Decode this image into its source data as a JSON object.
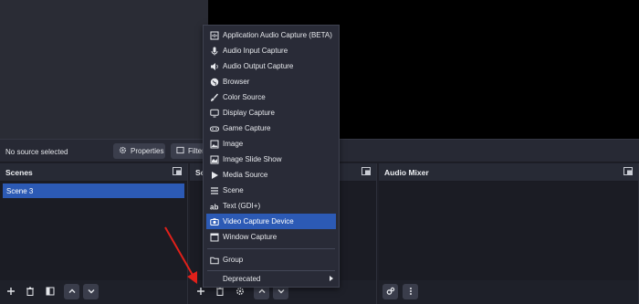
{
  "preview": {
    "status_text": "No source selected"
  },
  "source_toolbar": {
    "properties_label": "Properties",
    "filters_label": "Filters"
  },
  "docks": {
    "scenes_title": "Scenes",
    "sources_title": "So",
    "mixer_title": "Audio Mixer"
  },
  "scenes": {
    "items": [
      "Scene 3"
    ]
  },
  "add_source_menu": {
    "items": [
      {
        "label": "Application Audio Capture (BETA)",
        "icon": "app-audio-icon"
      },
      {
        "label": "Audio Input Capture",
        "icon": "microphone-icon"
      },
      {
        "label": "Audio Output Capture",
        "icon": "speaker-icon"
      },
      {
        "label": "Browser",
        "icon": "globe-icon"
      },
      {
        "label": "Color Source",
        "icon": "paintbrush-icon"
      },
      {
        "label": "Display Capture",
        "icon": "monitor-icon"
      },
      {
        "label": "Game Capture",
        "icon": "gamepad-icon"
      },
      {
        "label": "Image",
        "icon": "image-icon"
      },
      {
        "label": "Image Slide Show",
        "icon": "slideshow-icon"
      },
      {
        "label": "Media Source",
        "icon": "play-icon"
      },
      {
        "label": "Scene",
        "icon": "list-icon"
      },
      {
        "label": "Text (GDI+)",
        "icon": "text-icon"
      },
      {
        "label": "Video Capture Device",
        "icon": "camera-icon",
        "highlighted": true
      },
      {
        "label": "Window Capture",
        "icon": "window-icon"
      },
      {
        "label": "Group",
        "icon": "folder-icon"
      },
      {
        "label": "Deprecated",
        "icon": "",
        "submenu": true
      }
    ]
  },
  "colors": {
    "accent": "#2c5ab5",
    "arrow": "#e0201a",
    "background": "#1e1f28"
  }
}
